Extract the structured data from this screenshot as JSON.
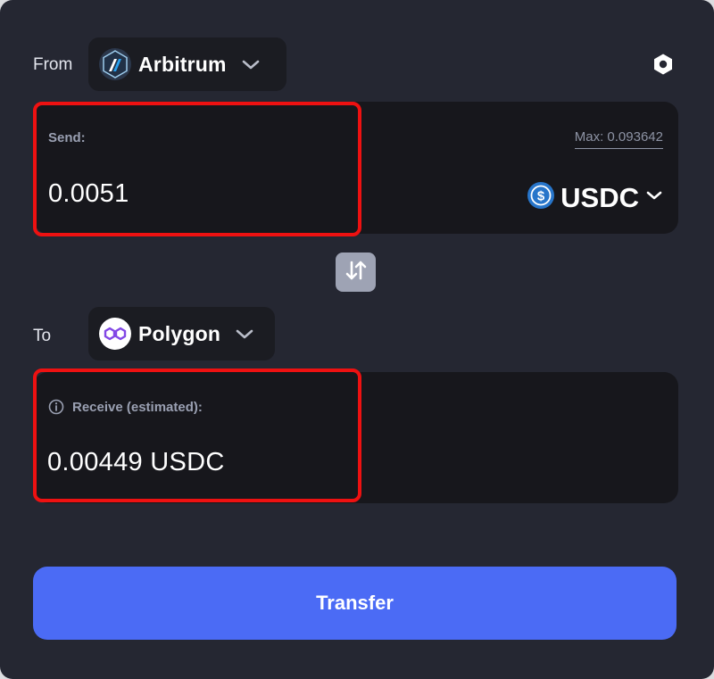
{
  "from": {
    "label": "From",
    "chain_name": "Arbitrum",
    "chain_icon": "arbitrum-logo-icon"
  },
  "settings": {
    "icon": "gear-icon"
  },
  "send": {
    "label": "Send:",
    "amount": "0.0051",
    "max_label": "Max: 0.093642",
    "token": "USDC",
    "token_icon": "usdc-logo-icon"
  },
  "swap": {
    "icon": "swap-direction-icon"
  },
  "to": {
    "label": "To",
    "chain_name": "Polygon",
    "chain_icon": "polygon-logo-icon"
  },
  "receive": {
    "label": "Receive (estimated):",
    "amount": "0.00449 USDC",
    "info_icon": "info-icon"
  },
  "transfer": {
    "label": "Transfer"
  },
  "colors": {
    "background": "#252732",
    "panel": "#17171c",
    "accent": "#4b6bf5",
    "highlight": "#ee1111"
  }
}
